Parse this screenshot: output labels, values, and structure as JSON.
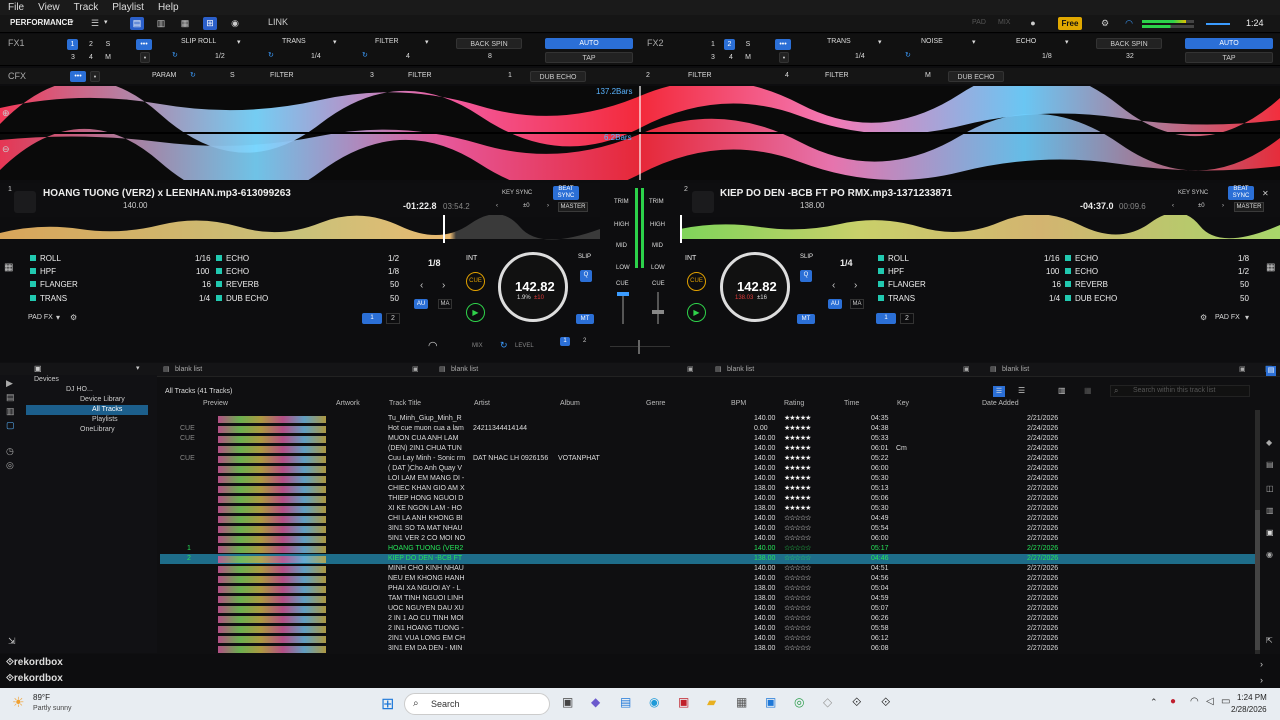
{
  "menu": [
    "File",
    "View",
    "Track",
    "Playlist",
    "Help"
  ],
  "toolbar": {
    "mode": "PERFORMANCE",
    "link": "LINK",
    "free": "Free",
    "clock": "1:24",
    "pad_label": "PAD",
    "mix_label": "MIX"
  },
  "fx1": {
    "label": "FX1",
    "beats": [
      "1",
      "2",
      "S",
      "3",
      "4",
      "M"
    ],
    "slots": [
      {
        "name": "SLIP ROLL",
        "val": "1/2"
      },
      {
        "name": "TRANS",
        "val": "1/4"
      },
      {
        "name": "FILTER",
        "val": "4"
      }
    ],
    "back_spin": "BACK SPIN",
    "auto": "AUTO",
    "tap": "TAP",
    "bs_val": "8"
  },
  "fx2": {
    "label": "FX2",
    "beats": [
      "1",
      "2",
      "S",
      "3",
      "4",
      "M"
    ],
    "slots": [
      {
        "name": "TRANS",
        "val": "1/4"
      },
      {
        "name": "NOISE",
        "val": ""
      },
      {
        "name": "ECHO",
        "val": "1/8"
      }
    ],
    "back_spin": "BACK SPIN",
    "auto": "AUTO",
    "tap": "TAP",
    "bs_val": "32"
  },
  "cfx": {
    "label": "CFX",
    "param": "PARAM",
    "s": "S",
    "items": [
      {
        "name": "FILTER",
        "v": "3"
      },
      {
        "name": "FILTER",
        "v": "1"
      },
      {
        "name": "DUB ECHO",
        "v": "2"
      },
      {
        "name": "FILTER",
        "v": "4"
      },
      {
        "name": "FILTER",
        "v": "M"
      },
      {
        "name": "DUB ECHO",
        "v": ""
      }
    ]
  },
  "overview": {
    "bars_top": "137.2Bars",
    "bars_bot": "6.2Bars"
  },
  "deck1": {
    "num": "1",
    "title": "HOANG TUONG (VER2) x LEENHAN.mp3-613099263",
    "bpm_small": "140.00",
    "time": "-01:22.8",
    "time2": "03:54.2",
    "key_sync": "KEY SYNC",
    "beat_sync": "BEAT SYNC",
    "master": "MASTER",
    "pm": "±0",
    "loop": "1/8",
    "int": "INT",
    "cue": "CUE",
    "bpm": "142.82",
    "pct": "1.9%",
    "pct2": "±10",
    "slip": "SLIP",
    "q": "Q",
    "au": "AU",
    "ma": "MA",
    "mt": "MT",
    "padfx": "PAD FX",
    "pages": [
      "1",
      "2"
    ],
    "pads": [
      {
        "n": "ROLL",
        "v": "1/16"
      },
      {
        "n": "HPF",
        "v": "100"
      },
      {
        "n": "FLANGER",
        "v": "16"
      },
      {
        "n": "TRANS",
        "v": "1/4"
      },
      {
        "n": "ECHO",
        "v": "1/2"
      },
      {
        "n": "ECHO",
        "v": "1/8"
      },
      {
        "n": "REVERB",
        "v": "50"
      },
      {
        "n": "DUB ECHO",
        "v": "50"
      }
    ]
  },
  "deck2": {
    "num": "2",
    "title": "KIEP DO DEN -BCB FT PO RMX.mp3-1371233871",
    "bpm_small": "138.00",
    "time": "-04:37.0",
    "time2": "00:09.6",
    "key_sync": "KEY SYNC",
    "beat_sync": "BEAT SYNC",
    "master": "MASTER",
    "pm": "±0",
    "loop": "1/4",
    "int": "INT",
    "cue": "CUE",
    "bpm": "142.82",
    "pct": "138.03",
    "pct2": "±16",
    "slip": "SLIP",
    "q": "Q",
    "au": "AU",
    "ma": "MA",
    "mt": "MT",
    "padfx": "PAD FX",
    "pages": [
      "1",
      "2"
    ],
    "pads": [
      {
        "n": "ROLL",
        "v": "1/16"
      },
      {
        "n": "HPF",
        "v": "100"
      },
      {
        "n": "FLANGER",
        "v": "16"
      },
      {
        "n": "TRANS",
        "v": "1/4"
      },
      {
        "n": "ECHO",
        "v": "1/8"
      },
      {
        "n": "ECHO",
        "v": "1/2"
      },
      {
        "n": "REVERB",
        "v": "50"
      },
      {
        "n": "DUB ECHO",
        "v": "50"
      }
    ]
  },
  "mixer": {
    "trim": "TRIM",
    "high": "HIGH",
    "mid": "MID",
    "low": "LOW",
    "cue": "CUE",
    "mix": "MIX",
    "level": "LEVEL"
  },
  "tabs": [
    "blank list",
    "blank list",
    "blank list",
    "blank list"
  ],
  "tree": {
    "devices": "Devices",
    "dj": "DJ HO...",
    "device_lib": "Device Library",
    "all_tracks": "All Tracks",
    "playlists": "Playlists",
    "onelibrary": "OneLibrary"
  },
  "browser": {
    "all_tracks": "All Tracks (41 Tracks)",
    "search_placeholder": "Search within this track list",
    "columns": [
      "Preview",
      "Artwork",
      "Track Title",
      "Artist",
      "Album",
      "Genre",
      "BPM",
      "Rating",
      "Time",
      "Key",
      "Date Added"
    ]
  },
  "tracks": [
    {
      "cue": "",
      "n": "",
      "title": "Tu_Minh_Giup_Minh_R",
      "artist": "",
      "album": "",
      "bpm": "140.00",
      "stars": 5,
      "time": "04:35",
      "key": "",
      "date": "2/21/2026"
    },
    {
      "cue": "CUE",
      "n": "",
      "title": "Hot cue muon cua a lam",
      "artist": "24211344414144",
      "album": "",
      "bpm": "0.00",
      "stars": 5,
      "time": "04:38",
      "key": "",
      "date": "2/24/2026"
    },
    {
      "cue": "CUE",
      "n": "",
      "title": "MUON CUA ANH LAM",
      "artist": "",
      "album": "",
      "bpm": "140.00",
      "stars": 5,
      "time": "05:33",
      "key": "",
      "date": "2/24/2026"
    },
    {
      "cue": "",
      "n": "",
      "title": "(DEN) 2IN1 CHUA TUN",
      "artist": "",
      "album": "",
      "bpm": "140.00",
      "stars": 5,
      "time": "06:01",
      "key": "Cm",
      "date": "2/24/2026"
    },
    {
      "cue": "CUE",
      "n": "",
      "title": "Cuu Lay Minh - Sonic rm",
      "artist": "DAT NHAC LH 0926156",
      "album": "VOTANPHAT",
      "bpm": "140.00",
      "stars": 5,
      "time": "05:22",
      "key": "",
      "date": "2/24/2026"
    },
    {
      "cue": "",
      "n": "",
      "title": "( DAT )Cho Anh Quay V",
      "artist": "",
      "album": "",
      "bpm": "140.00",
      "stars": 5,
      "time": "06:00",
      "key": "",
      "date": "2/24/2026"
    },
    {
      "cue": "",
      "n": "",
      "title": "LOI LAM EM MANG DI -",
      "artist": "",
      "album": "",
      "bpm": "140.00",
      "stars": 5,
      "time": "05:30",
      "key": "",
      "date": "2/24/2026"
    },
    {
      "cue": "",
      "n": "",
      "title": "CHIEC KHAN GIO AM X",
      "artist": "",
      "album": "",
      "bpm": "138.00",
      "stars": 5,
      "time": "05:13",
      "key": "",
      "date": "2/27/2026"
    },
    {
      "cue": "",
      "n": "",
      "title": "THIEP HONG NGUOI D",
      "artist": "",
      "album": "",
      "bpm": "140.00",
      "stars": 5,
      "time": "05:06",
      "key": "",
      "date": "2/27/2026"
    },
    {
      "cue": "",
      "n": "",
      "title": "XI KE NGON LAM - HO",
      "artist": "",
      "album": "",
      "bpm": "138.00",
      "stars": 5,
      "time": "05:30",
      "key": "",
      "date": "2/27/2026"
    },
    {
      "cue": "",
      "n": "",
      "title": "CHI LA ANH KHONG BI",
      "artist": "",
      "album": "",
      "bpm": "140.00",
      "stars": 0,
      "time": "04:49",
      "key": "",
      "date": "2/27/2026"
    },
    {
      "cue": "",
      "n": "",
      "title": "3IN1 SO TA MAT NHAU",
      "artist": "",
      "album": "",
      "bpm": "140.00",
      "stars": 0,
      "time": "05:54",
      "key": "",
      "date": "2/27/2026"
    },
    {
      "cue": "",
      "n": "",
      "title": "5IN1 VER 2 CO MOI NO",
      "artist": "",
      "album": "",
      "bpm": "140.00",
      "stars": 0,
      "time": "06:00",
      "key": "",
      "date": "2/27/2026"
    },
    {
      "cue": "",
      "n": "1",
      "title": "HOANG TUONG (VER2",
      "artist": "",
      "album": "",
      "bpm": "140.00",
      "stars": 0,
      "time": "05:17",
      "key": "",
      "date": "2/27/2026",
      "loaded": true
    },
    {
      "cue": "",
      "n": "2",
      "title": "KIEP DO DEN -BCB FT",
      "artist": "",
      "album": "",
      "bpm": "138.00",
      "stars": 0,
      "time": "04:46",
      "key": "",
      "date": "2/27/2026",
      "loaded": true,
      "sel": true
    },
    {
      "cue": "",
      "n": "",
      "title": "MINH CHO KINH NHAU",
      "artist": "",
      "album": "",
      "bpm": "140.00",
      "stars": 0,
      "time": "04:51",
      "key": "",
      "date": "2/27/2026"
    },
    {
      "cue": "",
      "n": "",
      "title": "NEU EM KHONG HANH",
      "artist": "",
      "album": "",
      "bpm": "140.00",
      "stars": 0,
      "time": "04:56",
      "key": "",
      "date": "2/27/2026"
    },
    {
      "cue": "",
      "n": "",
      "title": "PHAI XA NGUOI AY - L",
      "artist": "",
      "album": "",
      "bpm": "138.00",
      "stars": 0,
      "time": "05:04",
      "key": "",
      "date": "2/27/2026"
    },
    {
      "cue": "",
      "n": "",
      "title": "TAM TINH NGUOI LINH",
      "artist": "",
      "album": "",
      "bpm": "138.00",
      "stars": 0,
      "time": "04:59",
      "key": "",
      "date": "2/27/2026"
    },
    {
      "cue": "",
      "n": "",
      "title": "UOC NGUYEN DAU XU",
      "artist": "",
      "album": "",
      "bpm": "140.00",
      "stars": 0,
      "time": "05:07",
      "key": "",
      "date": "2/27/2026"
    },
    {
      "cue": "",
      "n": "",
      "title": "2 IN 1 AO CU TINH MOI",
      "artist": "",
      "album": "",
      "bpm": "140.00",
      "stars": 0,
      "time": "06:26",
      "key": "",
      "date": "2/27/2026"
    },
    {
      "cue": "",
      "n": "",
      "title": "2 IN1 HOANG TUONG -",
      "artist": "",
      "album": "",
      "bpm": "140.00",
      "stars": 0,
      "time": "05:58",
      "key": "",
      "date": "2/27/2026"
    },
    {
      "cue": "",
      "n": "",
      "title": "2IN1 VUA LONG EM CH",
      "artist": "",
      "album": "",
      "bpm": "140.00",
      "stars": 0,
      "time": "06:12",
      "key": "",
      "date": "2/27/2026"
    },
    {
      "cue": "",
      "n": "",
      "title": "3IN1 EM DA DEN - MIN",
      "artist": "",
      "album": "",
      "bpm": "138.00",
      "stars": 0,
      "time": "06:08",
      "key": "",
      "date": "2/27/2026"
    }
  ],
  "brand": {
    "line1": "rekordbox",
    "line2": "rekordbox"
  },
  "taskbar": {
    "temp": "89°F",
    "weather": "Partly sunny",
    "search": "Search",
    "time": "1:24 PM",
    "date": "2/28/2026"
  }
}
